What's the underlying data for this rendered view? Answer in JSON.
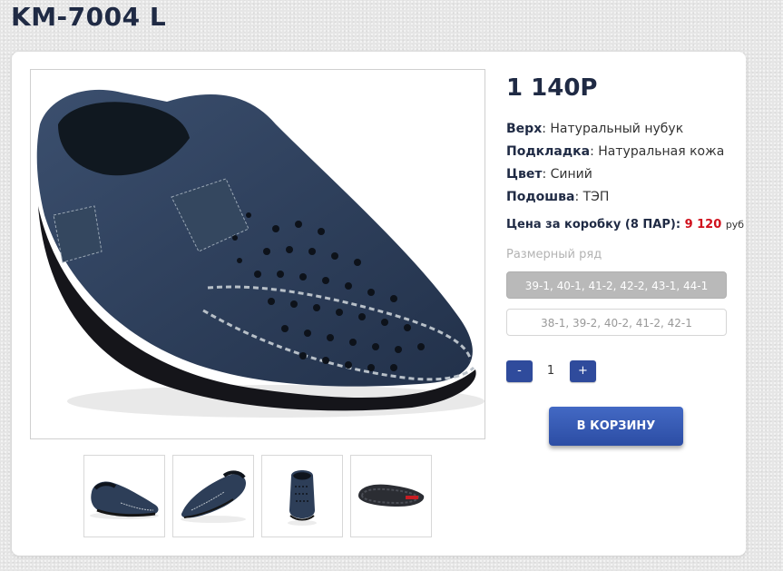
{
  "product": {
    "title": "KM-7004 L",
    "price": "1 140Р",
    "attributes": [
      {
        "label": "Верх",
        "value": "Натуральный нубук"
      },
      {
        "label": "Подкладка",
        "value": "Натуральная кожа"
      },
      {
        "label": "Цвет",
        "value": "Синий"
      },
      {
        "label": "Подошва",
        "value": "ТЭП"
      }
    ],
    "box_price": {
      "label": "Цена за коробку (8 ПАР):",
      "value": "9 120",
      "currency": "руб"
    }
  },
  "sizes": {
    "title": "Размерный ряд",
    "options": [
      {
        "label": "39-1, 40-1, 41-2, 42-2, 43-1, 44-1",
        "selected": true
      },
      {
        "label": "38-1, 39-2, 40-2, 41-2, 42-1",
        "selected": false
      }
    ]
  },
  "quantity": {
    "minus_label": "-",
    "value": "1",
    "plus_label": "+"
  },
  "cart": {
    "button_label": "В КОРЗИНУ"
  },
  "colors": {
    "accent": "#2f4b9c",
    "price_red": "#d0101c",
    "shoe_body": "#2d3e58"
  },
  "images": {
    "main_photo_icon": "shoe-photo",
    "thumbnails": [
      "shoe-side-view",
      "shoe-angle-view",
      "shoe-front-view",
      "shoe-sole-view"
    ]
  }
}
